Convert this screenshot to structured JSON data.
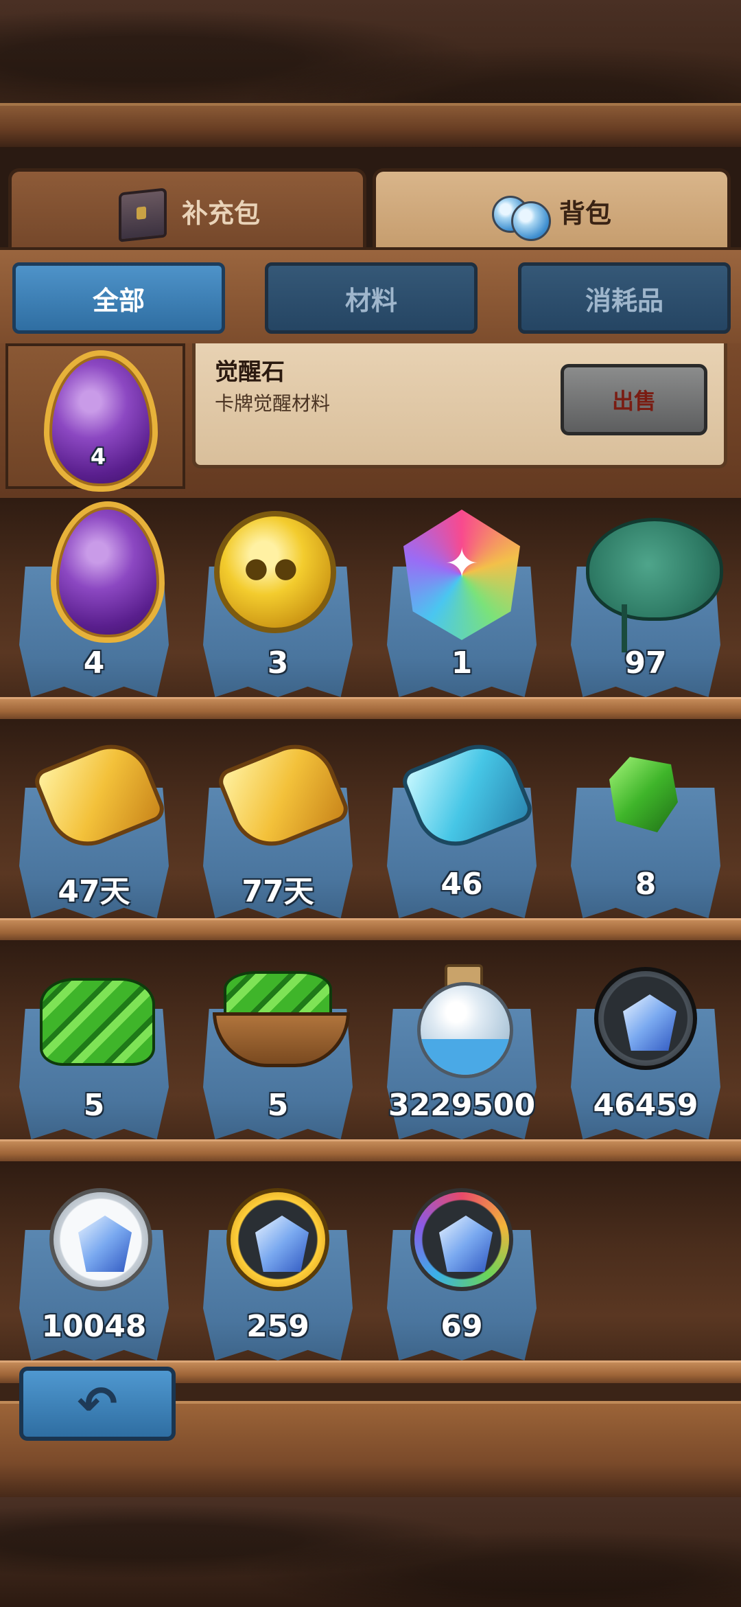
{
  "tabs": [
    {
      "label": "补充包",
      "icon": "chest-icon",
      "active": false
    },
    {
      "label": "背包",
      "icon": "potion-icon",
      "active": true
    }
  ],
  "filters": [
    {
      "label": "全部",
      "active": true
    },
    {
      "label": "材料",
      "active": false
    },
    {
      "label": "消耗品",
      "active": false
    }
  ],
  "selected_item": {
    "name": "觉醒石",
    "description": "卡牌觉醒材料",
    "count": "4",
    "icon": "awakening-stone-icon",
    "sell_label": "出售"
  },
  "items": [
    {
      "icon": "awakening-stone-icon",
      "count": "4"
    },
    {
      "icon": "owl-coin-icon",
      "count": "3"
    },
    {
      "icon": "rainbow-gem-icon",
      "count": "1"
    },
    {
      "icon": "lotus-leaf-icon",
      "count": "97"
    },
    {
      "icon": "gold-scroll-icon",
      "count": "47天"
    },
    {
      "icon": "gold-scroll-icon",
      "count": "77天"
    },
    {
      "icon": "blue-scroll-icon",
      "count": "46"
    },
    {
      "icon": "green-crystal-icon",
      "count": "8"
    },
    {
      "icon": "green-crystal-pile-icon",
      "count": "5"
    },
    {
      "icon": "crystal-basket-icon",
      "count": "5"
    },
    {
      "icon": "sand-bottle-icon",
      "count": "3229500"
    },
    {
      "icon": "dark-gem-token-icon",
      "count": "46459"
    },
    {
      "icon": "silver-gem-token-icon",
      "count": "10048"
    },
    {
      "icon": "gold-gem-token-icon",
      "count": "259"
    },
    {
      "icon": "rainbow-gem-token-icon",
      "count": "69"
    }
  ],
  "back_button": {
    "icon": "back-arrow-icon"
  }
}
